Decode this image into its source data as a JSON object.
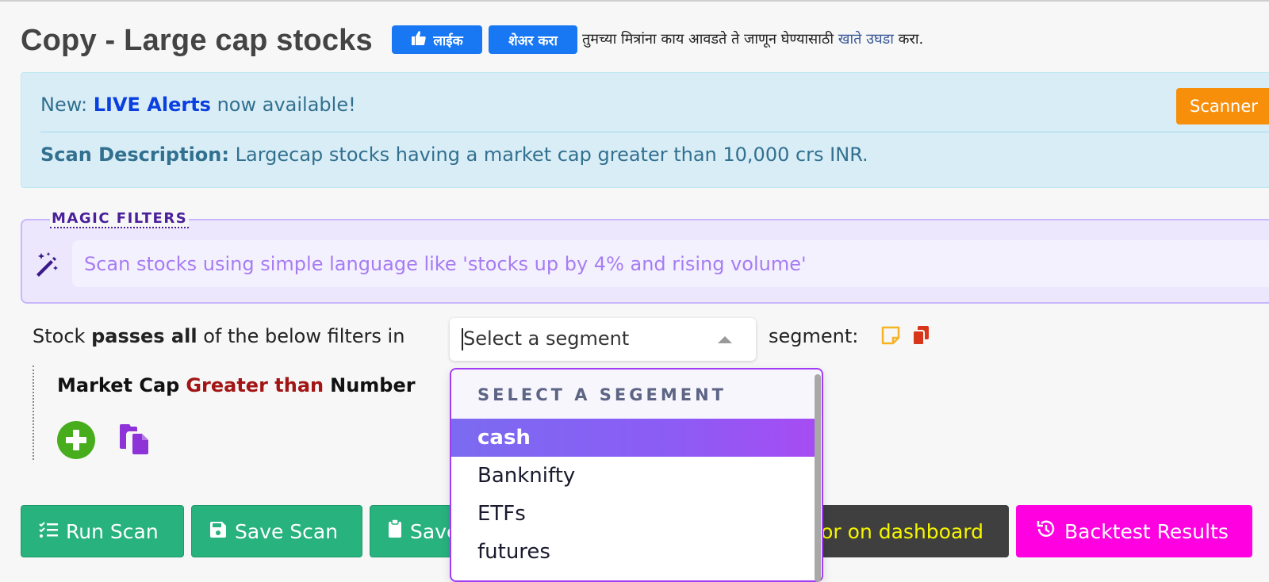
{
  "page": {
    "title": "Copy - Large cap stocks"
  },
  "facebook": {
    "like_label": "लाईक",
    "share_label": "शेअर करा",
    "text_before": "तुमच्या मित्रांना काय आवडते ते जाणून घेण्यासाठी ",
    "link_text": "खाते उघडा",
    "text_after": " करा."
  },
  "alert": {
    "prefix": "New: ",
    "highlight": "LIVE Alerts",
    "suffix": " now available!",
    "desc_label": "Scan Description:",
    "desc_text": " Largecap stocks having a market cap greater than 10,000 crs INR.",
    "scanner_button": "Scanner"
  },
  "magic": {
    "legend": "MAGIC FILTERS",
    "placeholder": "Scan stocks using simple language like 'stocks up by 4% and rising volume'"
  },
  "filter": {
    "prefix": "Stock ",
    "passes": "passes all",
    "middle": "  of the below filters in",
    "segment_placeholder": "Select a segment",
    "suffix": "segment:"
  },
  "criteria": {
    "label": "Market Cap",
    "operator": "Greater than",
    "value": "Number"
  },
  "dropdown": {
    "header": "SELECT A SEGEMENT",
    "items": [
      "cash",
      "Banknifty",
      "ETFs",
      "futures"
    ],
    "selected": "cash"
  },
  "buttons": {
    "run": "Run Scan",
    "save": "Save Scan",
    "save_as": "Save As",
    "monitor": "or on dashboard",
    "backtest": "Backtest Results"
  },
  "colors": {
    "green": "#27b27e",
    "magenta": "#ff00e1",
    "orange": "#f78f0b",
    "purple": "#a23cf4",
    "fb_blue": "#1877f2"
  }
}
